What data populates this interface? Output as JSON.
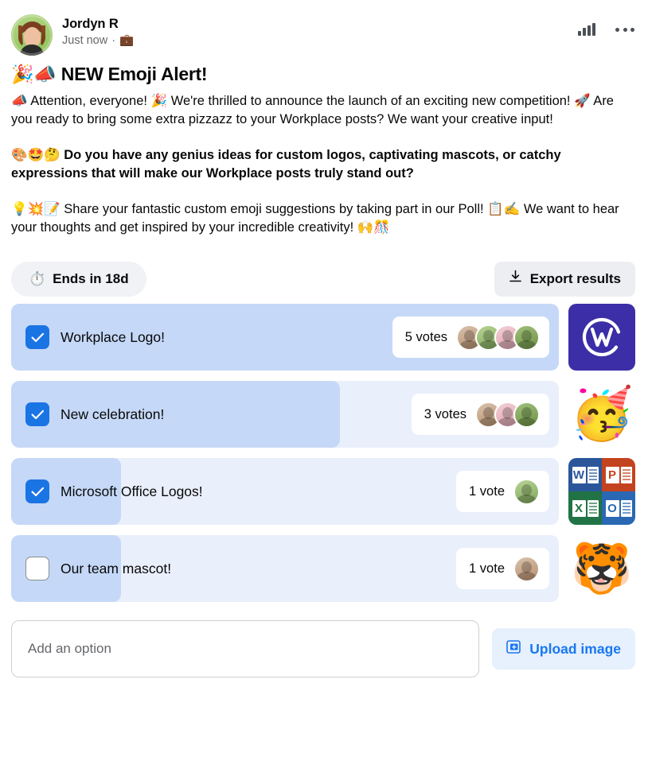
{
  "post": {
    "author": "Jordyn R",
    "timestamp": "Just now",
    "meta_separator": "·",
    "audience_icon": "briefcase-icon",
    "avatar_alt": "Jordyn R profile photo",
    "title": "🎉📣 NEW Emoji Alert!",
    "paragraphs": [
      {
        "bold": false,
        "text": "📣 Attention, everyone! 🎉 We're thrilled to announce the launch of an exciting new competition! 🚀 Are you ready to bring some extra pizzazz to your Workplace posts? We want your creative input!"
      },
      {
        "bold": true,
        "text": "🎨🤩🤔 Do you have any genius ideas for custom logos, captivating mascots, or catchy expressions that will make our Workplace posts truly stand out?"
      },
      {
        "bold": false,
        "text": "💡💥📝 Share your fantastic custom emoji suggestions by taking part in our Poll! 📋✍️ We want to hear your thoughts and get inspired by your incredible creativity! 🙌🎊"
      }
    ],
    "header_actions": [
      {
        "name": "insights-icon",
        "label": "Insights"
      },
      {
        "name": "more-options-icon",
        "label": "More options"
      }
    ]
  },
  "poll": {
    "ends_label": "Ends in 18d",
    "ends_icon": "stopwatch-icon",
    "export_label": "Export results",
    "export_icon": "download-icon",
    "options": [
      {
        "label": "Workplace Logo!",
        "votes_text": "5 votes",
        "votes": 5,
        "checked": true,
        "fill_percent": 100,
        "avatars": 4,
        "thumbnail": "workplace-logo",
        "thumbnail_alt": "Workplace logo"
      },
      {
        "label": "New celebration!",
        "votes_text": "3 votes",
        "votes": 3,
        "checked": true,
        "fill_percent": 60,
        "avatars": 3,
        "thumbnail": "partying-face-emoji",
        "thumbnail_alt": "Partying face emoji",
        "thumbnail_glyph": "🥳"
      },
      {
        "label": "Microsoft Office Logos!",
        "votes_text": "1 vote",
        "votes": 1,
        "checked": true,
        "fill_percent": 20,
        "avatars": 1,
        "thumbnail": "microsoft-office-logos",
        "thumbnail_alt": "Microsoft Office logos"
      },
      {
        "label": "Our team mascot!",
        "votes_text": "1 vote",
        "votes": 1,
        "checked": false,
        "fill_percent": 20,
        "avatars": 1,
        "thumbnail": "tiger-mascot",
        "thumbnail_alt": "Tiger mascot logo",
        "thumbnail_glyph": "🐯"
      }
    ],
    "add_option_placeholder": "Add an option",
    "upload_label": "Upload image",
    "upload_icon": "image-plus-icon"
  },
  "ms_office": {
    "cells": [
      {
        "name": "word",
        "letter": "W",
        "color": "#2b579a"
      },
      {
        "name": "powerpoint",
        "letter": "P",
        "color": "#c4431f"
      },
      {
        "name": "excel",
        "letter": "X",
        "color": "#217346"
      },
      {
        "name": "outlook",
        "letter": "O",
        "color": "#2a68b4"
      }
    ]
  },
  "colors": {
    "accent_blue": "#1b74e4",
    "link_blue": "#1877f2",
    "fill_blue": "#c5d8f7",
    "track_blue": "#e9effb",
    "workplace_purple": "#3b2ea6",
    "muted_text": "#65676b",
    "chip_gray": "#f0f2f5"
  }
}
